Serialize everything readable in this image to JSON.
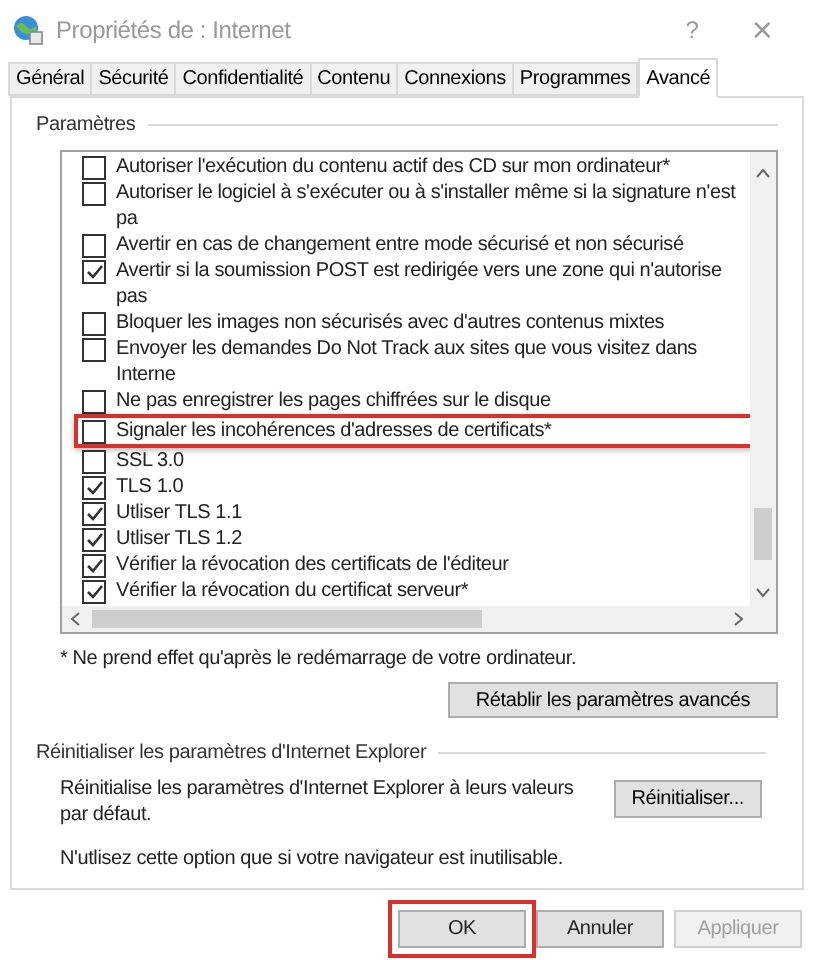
{
  "window": {
    "title": "Propriétés de : Internet",
    "help": "?",
    "close": "×"
  },
  "tabs": [
    {
      "label": "Général",
      "selected": false
    },
    {
      "label": "Sécurité",
      "selected": false
    },
    {
      "label": "Confidentialité",
      "selected": false
    },
    {
      "label": "Contenu",
      "selected": false
    },
    {
      "label": "Connexions",
      "selected": false
    },
    {
      "label": "Programmes",
      "selected": false
    },
    {
      "label": "Avancé",
      "selected": true
    }
  ],
  "settings": {
    "title": "Paramètres",
    "items": [
      {
        "label": "Autoriser l'exécution du contenu actif des CD sur mon ordinateur*",
        "checked": false,
        "highlighted": false
      },
      {
        "label": "Autoriser le logiciel à s'exécuter ou à s'installer même si la signature n'est pa",
        "checked": false,
        "highlighted": false
      },
      {
        "label": "Avertir en cas de changement entre mode sécurisé et non sécurisé",
        "checked": false,
        "highlighted": false
      },
      {
        "label": "Avertir si la soumission POST est redirigée vers une zone qui n'autorise pas",
        "checked": true,
        "highlighted": false
      },
      {
        "label": "Bloquer les images non sécurisés avec d'autres contenus mixtes",
        "checked": false,
        "highlighted": false
      },
      {
        "label": "Envoyer les demandes Do Not Track aux sites que vous visitez dans Interne",
        "checked": false,
        "highlighted": false
      },
      {
        "label": "Ne pas enregistrer les pages chiffrées sur le disque",
        "checked": false,
        "highlighted": false
      },
      {
        "label": "Signaler les incohérences d'adresses de certificats*",
        "checked": false,
        "highlighted": true
      },
      {
        "label": "SSL 3.0",
        "checked": false,
        "highlighted": false
      },
      {
        "label": "TLS 1.0",
        "checked": true,
        "highlighted": false
      },
      {
        "label": "Utliser TLS 1.1",
        "checked": true,
        "highlighted": false
      },
      {
        "label": "Utliser TLS 1.2",
        "checked": true,
        "highlighted": false
      },
      {
        "label": "Vérifier la révocation des certificats de l'éditeur",
        "checked": true,
        "highlighted": false
      },
      {
        "label": "Vérifier la révocation du certificat serveur*",
        "checked": true,
        "highlighted": false
      }
    ],
    "footnote": "* Ne prend effet qu'après le redémarrage de votre ordinateur.",
    "restore_button": "Rétablir les paramètres avancés"
  },
  "reset": {
    "title": "Réinitialiser les paramètres d'Internet Explorer",
    "description": "Réinitialise les paramètres d'Internet Explorer à leurs valeurs par défaut.",
    "button": "Réinitialiser...",
    "note": "N'utlisez cette option que si votre navigateur est inutilisable."
  },
  "buttons": [
    {
      "label": "OK",
      "disabled": false,
      "highlighted": true
    },
    {
      "label": "Annuler",
      "disabled": false,
      "highlighted": false
    },
    {
      "label": "Appliquer",
      "disabled": true,
      "highlighted": false
    }
  ]
}
